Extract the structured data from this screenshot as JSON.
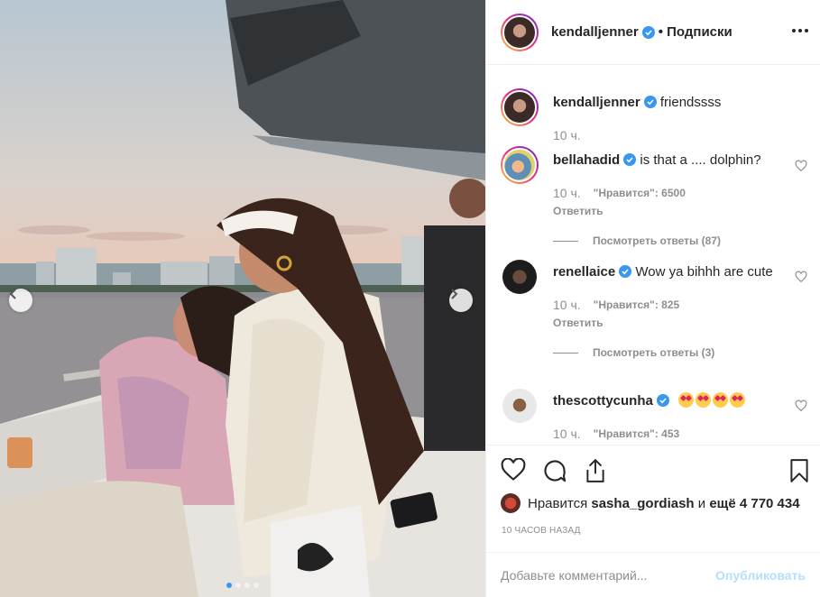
{
  "post": {
    "author": "kendalljenner",
    "follow_label": "• Подписки",
    "caption_author": "kendalljenner",
    "caption_text": "friendssss",
    "caption_time": "10 ч."
  },
  "comments": [
    {
      "user": "bellahadid",
      "text": "is that a .... dolphin?",
      "time": "10 ч.",
      "likes": "\"Нравится\": 6500",
      "reply": "Ответить",
      "view_replies": "Посмотреть ответы (87)"
    },
    {
      "user": "renellaice",
      "text": "Wow ya bihhh are cute",
      "time": "10 ч.",
      "likes": "\"Нравится\": 825",
      "reply": "Ответить",
      "view_replies": "Посмотреть ответы (3)"
    },
    {
      "user": "thescottycunha",
      "text": "",
      "time": "10 ч.",
      "likes": "\"Нравится\": 453"
    }
  ],
  "likes": {
    "prefix": "Нравится",
    "user": "sasha_gordiash",
    "and": "и",
    "count": "ещё 4 770 434"
  },
  "time_ago": "10 ЧАСОВ НАЗАД",
  "comment_box": {
    "placeholder": "Добавьте комментарий...",
    "publish": "Опубликовать"
  },
  "icons": [
    "chevron-left-icon",
    "chevron-right-icon",
    "more-icon",
    "verified-icon",
    "heart-icon",
    "comment-icon",
    "share-icon",
    "bookmark-icon",
    "heart-eyes-emoji"
  ],
  "colors": {
    "verified": "#3897f0",
    "text": "#262626",
    "muted": "#8e8e8e",
    "publish_disabled": "#b2dffc"
  }
}
